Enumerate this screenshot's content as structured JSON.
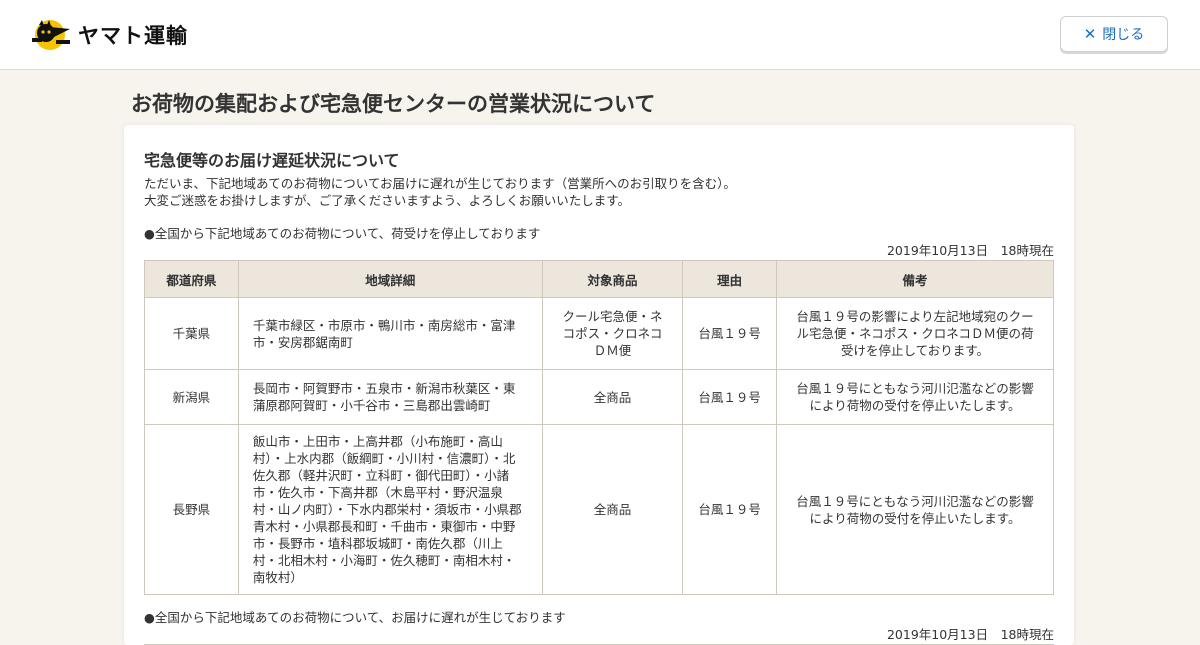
{
  "header": {
    "logo_text": "ヤマト運輸",
    "close_label": "閉じる"
  },
  "page": {
    "title": "お荷物の集配および宅急便センターの営業状況について"
  },
  "section": {
    "title": "宅急便等のお届け遅延状況について",
    "lines": [
      "ただいま、下記地域あてのお荷物についてお届けに遅れが生じております（営業所へのお引取りを含む）。",
      "大変ご迷惑をお掛けしますが、ご了承くださいますよう、よろしくお願いいたします。"
    ],
    "notice1": "●全国から下記地域あてのお荷物について、荷受けを停止しております",
    "timestamp1": "2019年10月13日　18時現在",
    "notice2": "●全国から下記地域あてのお荷物について、お届けに遅れが生じております",
    "timestamp2": "2019年10月13日　18時現在"
  },
  "table": {
    "headers": [
      "都道府県",
      "地域詳細",
      "対象商品",
      "理由",
      "備考"
    ],
    "rows": [
      {
        "prefecture": "千葉県",
        "area": "千葉市緑区・市原市・鴨川市・南房総市・富津市・安房郡鋸南町",
        "product": "クール宅急便・ネコポス・クロネコＤＭ便",
        "reason": "台風１９号",
        "note": "台風１９号の影響により左記地域宛のクール宅急便・ネコポス・クロネコＤＭ便の荷受けを停止しております。"
      },
      {
        "prefecture": "新潟県",
        "area": "長岡市・阿賀野市・五泉市・新潟市秋葉区・東蒲原郡阿賀町・小千谷市・三島郡出雲崎町",
        "product": "全商品",
        "reason": "台風１９号",
        "note": "台風１９号にともなう河川氾濫などの影響により荷物の受付を停止いたします。"
      },
      {
        "prefecture": "長野県",
        "area": "飯山市・上田市・上高井郡（小布施町・高山村）・上水内郡（飯綱町・小川村・信濃町）・北佐久郡（軽井沢町・立科町・御代田町）・小諸市・佐久市・下高井郡（木島平村・野沢温泉村・山ノ内町）・下水内郡栄村・須坂市・小県郡青木村・小県郡長和町・千曲市・東御市・中野市・長野市・埴科郡坂城町・南佐久郡（川上村・北相木村・小海町・佐久穂町・南相木村・南牧村）",
        "product": "全商品",
        "reason": "台風１９号",
        "note": "台風１９号にともなう河川氾濫などの影響により荷物の受付を停止いたします。"
      }
    ]
  },
  "colors": {
    "accent": "#1f6fb7",
    "header_cell_bg": "#ece6dc",
    "page_bg": "#f7f4ee",
    "logo_yellow": "#f5c400"
  },
  "icons": {
    "logo": "black-cat-logo-icon",
    "close": "close-icon"
  }
}
